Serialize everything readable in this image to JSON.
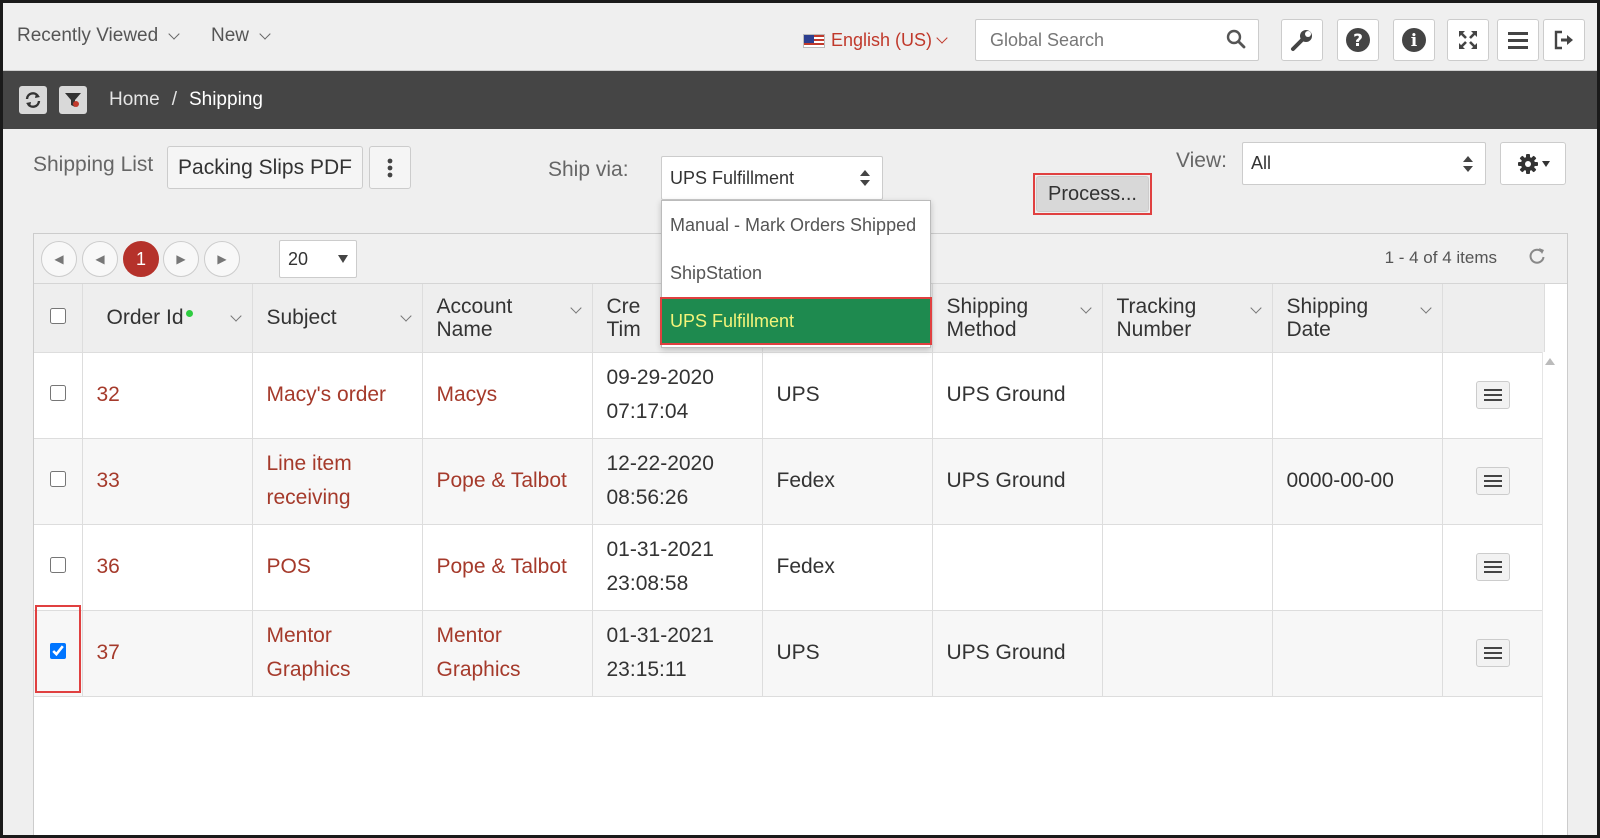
{
  "topnav": {
    "recently_viewed": "Recently Viewed",
    "new": "New",
    "language": "English (US)",
    "search_placeholder": "Global Search"
  },
  "breadcrumb": {
    "home": "Home",
    "separator": "/",
    "current": "Shipping"
  },
  "toolbar": {
    "list_label": "Shipping List",
    "packing_slips": "Packing Slips PDF",
    "ship_via_label": "Ship via:",
    "ship_via_value": "UPS Fulfillment",
    "process": "Process...",
    "view_label": "View:",
    "view_value": "All"
  },
  "ship_via_options": [
    "Manual - Mark Orders Shipped",
    "ShipStation",
    "UPS Fulfillment"
  ],
  "pager": {
    "current_page": "1",
    "page_size": "20",
    "info": "1 - 4 of 4 items"
  },
  "columns": {
    "order_id": "Order Id",
    "subject": "Subject",
    "account_name_1": "Account",
    "account_name_2": "Name",
    "created_1": "Cre",
    "created_2": "Tim",
    "shipping_method_1": "Shipping",
    "shipping_method_2": "Method",
    "tracking_1": "Tracking",
    "tracking_2": "Number",
    "shipping_date_1": "Shipping",
    "shipping_date_2": "Date"
  },
  "rows": [
    {
      "order_id": "32",
      "subject_1": "Macy's order",
      "subject_2": "",
      "account_1": "Macys",
      "account_2": "",
      "date": "09-29-2020",
      "time": "07:17:04",
      "carrier": "UPS",
      "method": "UPS Ground",
      "tracking": "",
      "ship_date": "",
      "checked": false
    },
    {
      "order_id": "33",
      "subject_1": "Line item",
      "subject_2": "receiving",
      "account_1": "Pope & Talbot",
      "account_2": "",
      "date": "12-22-2020",
      "time": "08:56:26",
      "carrier": "Fedex",
      "method": "UPS Ground",
      "tracking": "",
      "ship_date": "0000-00-00",
      "checked": false
    },
    {
      "order_id": "36",
      "subject_1": "POS",
      "subject_2": "",
      "account_1": "Pope & Talbot",
      "account_2": "",
      "date": "01-31-2021",
      "time": "23:08:58",
      "carrier": "Fedex",
      "method": "",
      "tracking": "",
      "ship_date": "",
      "checked": false
    },
    {
      "order_id": "37",
      "subject_1": "Mentor",
      "subject_2": "Graphics",
      "account_1": "Mentor",
      "account_2": "Graphics",
      "date": "01-31-2021",
      "time": "23:15:11",
      "carrier": "UPS",
      "method": "UPS Ground",
      "tracking": "",
      "ship_date": "",
      "checked": true
    }
  ],
  "colors": {
    "link": "#a53a2b",
    "accent_red": "#b5322b",
    "selected_green": "#1e8a4f",
    "highlight_outline": "#e04040"
  }
}
